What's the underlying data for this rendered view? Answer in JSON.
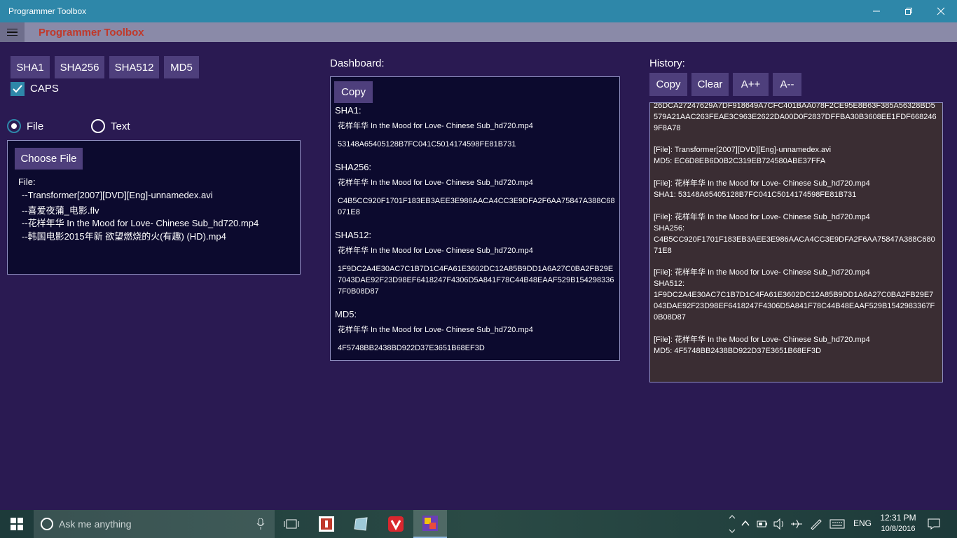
{
  "window": {
    "title": "Programmer Toolbox"
  },
  "app": {
    "title": "Programmer Toolbox"
  },
  "hash_buttons": [
    "SHA1",
    "SHA256",
    "SHA512",
    "MD5"
  ],
  "caps": {
    "label": "CAPS",
    "checked": true
  },
  "mode": {
    "file_label": "File",
    "text_label": "Text",
    "selected": "File"
  },
  "file_panel": {
    "choose_label": "Choose File",
    "heading": "File:",
    "files": [
      "--Transformer[2007][DVD][Eng]-unnamedex.avi",
      "--喜爱夜蒲_电影.flv",
      "--花样年华 In the Mood for Love- Chinese Sub_hd720.mp4",
      "--韩国电影2015年新  欲望燃烧的火(有趣) (HD).mp4"
    ]
  },
  "dashboard": {
    "heading": "Dashboard:",
    "copy_label": "Copy",
    "sections": [
      {
        "label": "SHA1:",
        "file": "花样年华 In the Mood for Love- Chinese Sub_hd720.mp4",
        "hash": "53148A65405128B7FC041C5014174598FE81B731"
      },
      {
        "label": "SHA256:",
        "file": "花样年华 In the Mood for Love- Chinese Sub_hd720.mp4",
        "hash": "C4B5CC920F1701F183EB3AEE3E986AACA4CC3E9DFA2F6AA75847A388C68071E8"
      },
      {
        "label": "SHA512:",
        "file": "花样年华 In the Mood for Love- Chinese Sub_hd720.mp4",
        "hash": "1F9DC2A4E30AC7C1B7D1C4FA61E3602DC12A85B9DD1A6A27C0BA2FB29E7043DAE92F23D98EF6418247F4306D5A841F78C44B48EAAF529B1542983367F0B08D87"
      },
      {
        "label": "MD5:",
        "file": "花样年华 In the Mood for Love- Chinese Sub_hd720.mp4",
        "hash": "4F5748BB2438BD922D37E3651B68EF3D"
      }
    ]
  },
  "history": {
    "heading": "History:",
    "buttons": {
      "copy": "Copy",
      "clear": "Clear",
      "font_up": "A++",
      "font_down": "A--"
    },
    "lines": [
      "26DCA27247629A7DF918649A7CFC401BAA078F2CE95E8B63F385A56328BD5579A21AAC263FEAE3C963E2622DA00D0F2837DFFBA30B3608EE1FDF6682469F8A78",
      "[File]: Transformer[2007][DVD][Eng]-unnamedex.avi",
      "MD5: EC6D8EB6D0B2C319EB724580ABE37FFA",
      "[File]: 花样年华 In the Mood for Love- Chinese Sub_hd720.mp4",
      "SHA1: 53148A65405128B7FC041C5014174598FE81B731",
      "[File]: 花样年华 In the Mood for Love- Chinese Sub_hd720.mp4",
      "SHA256:",
      "C4B5CC920F1701F183EB3AEE3E986AACA4CC3E9DFA2F6AA75847A388C68071E8",
      "[File]: 花样年华 In the Mood for Love- Chinese Sub_hd720.mp4",
      "SHA512:",
      "1F9DC2A4E30AC7C1B7D1C4FA61E3602DC12A85B9DD1A6A27C0BA2FB29E7043DAE92F23D98EF6418247F4306D5A841F78C44B48EAAF529B1542983367F0B08D87",
      "[File]: 花样年华 In the Mood for Love- Chinese Sub_hd720.mp4",
      "MD5: 4F5748BB2438BD922D37E3651B68EF3D"
    ]
  },
  "taskbar": {
    "search_placeholder": "Ask me anything",
    "language": "ENG",
    "time": "12:31 PM",
    "date": "10/8/2016"
  },
  "colors": {
    "accent": "#2e87a9",
    "background": "#2a1a52",
    "app_title": "#c0392b"
  }
}
